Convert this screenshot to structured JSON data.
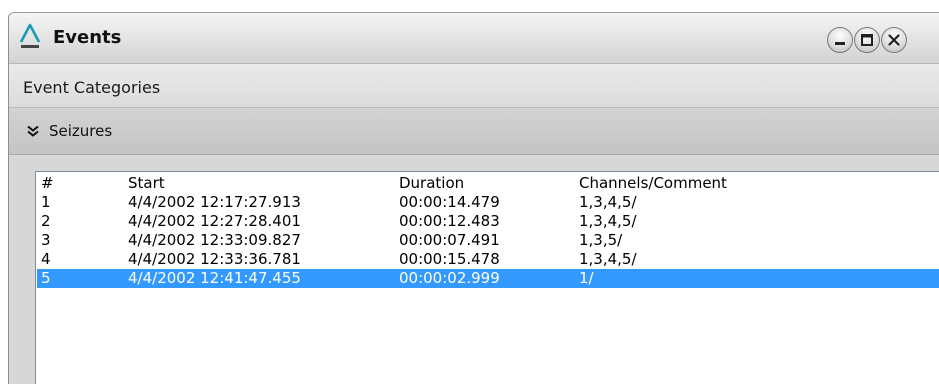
{
  "window": {
    "title": "Events",
    "buttons": [
      "minimize",
      "maximize",
      "close"
    ]
  },
  "categories_header": "Event Categories",
  "group": {
    "label": "Seizures",
    "expanded": true
  },
  "table": {
    "columns": [
      "#",
      "Start",
      "Duration",
      "Channels/Comment"
    ],
    "rows": [
      {
        "num": "1",
        "start": "4/4/2002 12:17:27.913",
        "duration": "00:00:14.479",
        "channels": "1,3,4,5/"
      },
      {
        "num": "2",
        "start": "4/4/2002 12:27:28.401",
        "duration": "00:00:12.483",
        "channels": "1,3,4,5/"
      },
      {
        "num": "3",
        "start": "4/4/2002 12:33:09.827",
        "duration": "00:00:07.491",
        "channels": "1,3,5/"
      },
      {
        "num": "4",
        "start": "4/4/2002 12:33:36.781",
        "duration": "00:00:15.478",
        "channels": "1,3,4,5/"
      },
      {
        "num": "5",
        "start": "4/4/2002 12:41:47.455",
        "duration": "00:00:02.999",
        "channels": "1/"
      }
    ],
    "selected_row": "5"
  },
  "colors": {
    "accent": "#3399ff",
    "logo": "#1a9bb5"
  }
}
